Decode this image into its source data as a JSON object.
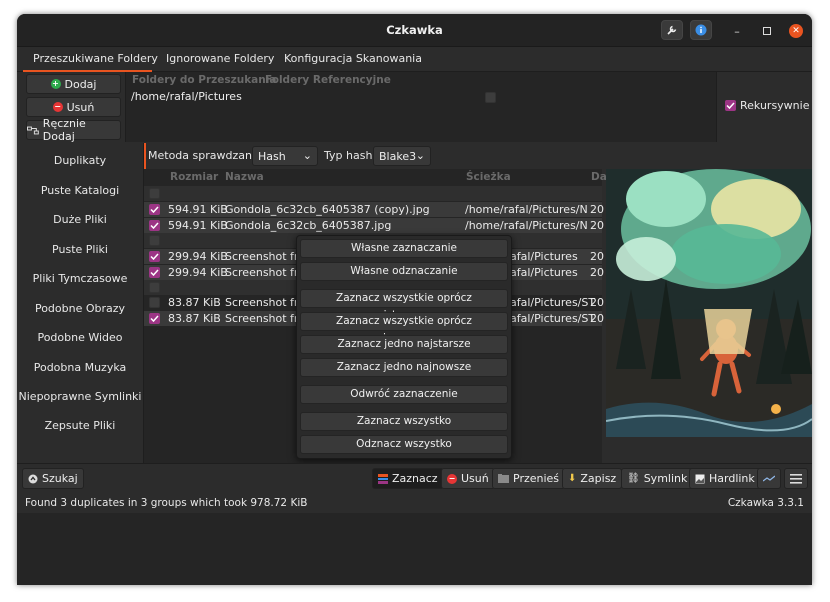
{
  "window": {
    "title": "Czkawka"
  },
  "tabs": [
    "Przeszukiwane Foldery",
    "Ignorowane Foldery",
    "Konfiguracja Skanowania"
  ],
  "folder_buttons": {
    "add": "Dodaj",
    "remove": "Usuń",
    "manual_add": "Ręcznie Dodaj"
  },
  "folders_table": {
    "col_folders": "Foldery do Przeszukania",
    "col_reference": "Foldery Referencyjne",
    "rows": [
      {
        "path": "/home/rafal/Pictures",
        "reference": false
      }
    ]
  },
  "recursive": {
    "label": "Rekursywnie",
    "checked": true
  },
  "nav": [
    "Duplikaty",
    "Puste Katalogi",
    "Duże Pliki",
    "Puste Pliki",
    "Pliki Tymczasowe",
    "Podobne Obrazy",
    "Podobne Wideo",
    "Podobna Muzyka",
    "Niepoprawne Symlinki",
    "Zepsute Pliki"
  ],
  "method": {
    "label": "Metoda sprawdzania",
    "value": "Hash",
    "hash_label": "Typ hashu",
    "hash_value": "Blake3"
  },
  "results": {
    "columns": {
      "size": "Rozmiar",
      "name": "Nazwa",
      "path": "Ścieżka",
      "date": "Da"
    },
    "rows": [
      {
        "type": "group"
      },
      {
        "type": "file",
        "checked": true,
        "size": "594.91 KiB",
        "name": "Gondola_6c32cb_6405387 (copy).jpg",
        "path": "/home/rafal/Pictures/N",
        "date": "20"
      },
      {
        "type": "file",
        "checked": true,
        "size": "594.91 KiB",
        "name": "Gondola_6c32cb_6405387.jpg",
        "path": "/home/rafal/Pictures/N",
        "date": "20"
      },
      {
        "type": "group"
      },
      {
        "type": "file",
        "checked": true,
        "size": "299.94 KiB",
        "name": "Screenshot fro",
        "path": "afal/Pictures",
        "date": "20"
      },
      {
        "type": "file",
        "checked": true,
        "size": "299.94 KiB",
        "name": "Screenshot fro",
        "path": "afal/Pictures",
        "date": "20"
      },
      {
        "type": "group"
      },
      {
        "type": "file",
        "checked": false,
        "size": "83.87 KiB",
        "name": "Screenshot fro",
        "path": "afal/Pictures/ST",
        "date": "20"
      },
      {
        "type": "file",
        "checked": true,
        "size": "83.87 KiB",
        "name": "Screenshot fro",
        "path": "afal/Pictures/ST",
        "date": "20"
      }
    ]
  },
  "context_menu": [
    "Własne zaznaczanie",
    "Własne odznaczanie",
    "Zaznacz wszystkie oprócz najstarszego",
    "Zaznacz wszystkie oprócz najnowszego",
    "Zaznacz jedno najstarsze",
    "Zaznacz jedno najnowsze",
    "Odwróć zaznaczenie",
    "Zaznacz wszystko",
    "Odznacz wszystko"
  ],
  "bottom": {
    "search": "Szukaj",
    "select": "Zaznacz",
    "delete": "Usuń",
    "move": "Przenieś",
    "save": "Zapisz",
    "symlink": "Symlink",
    "hardlink": "Hardlink"
  },
  "status": {
    "message": "Found 3 duplicates in 3 groups which took 978.72 KiB",
    "version": "Czkawka 3.3.1"
  },
  "colors": {
    "accent": "#e95420",
    "check": "#9c3585",
    "bg": "#2c2c2c"
  },
  "icons": [
    "wrench-icon",
    "info-icon",
    "minimize-icon",
    "maximize-icon",
    "close-icon",
    "search-icon",
    "trash-icon",
    "folder-icon",
    "save-icon",
    "link-icon",
    "image-icon",
    "menu-icon"
  ]
}
